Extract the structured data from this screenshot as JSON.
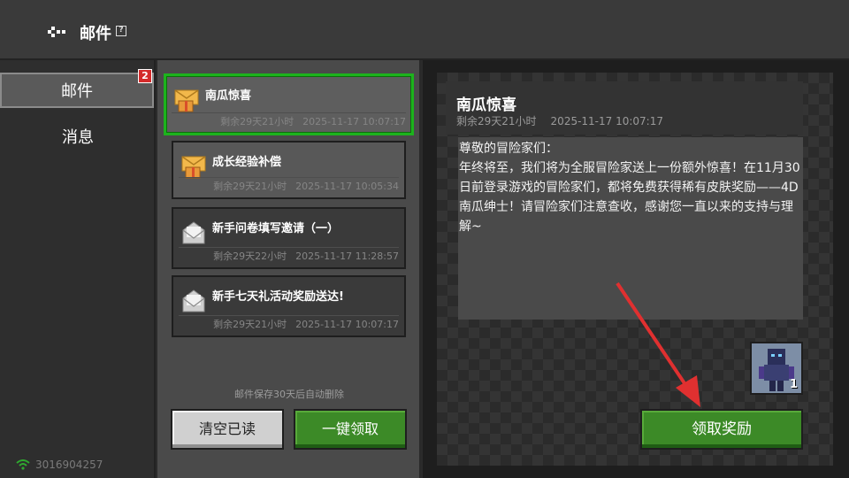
{
  "topbar": {
    "title": "邮件",
    "back_icon": "back-arrow-icon",
    "help_icon": "help-icon",
    "help_glyph": "?"
  },
  "sidebar": {
    "items": [
      {
        "label": "邮件",
        "active": true,
        "badge": "2"
      },
      {
        "label": "消息",
        "active": false
      }
    ],
    "uid": "3016904257"
  },
  "mails": [
    {
      "title": "南瓜惊喜",
      "remaining": "剩余29天21小时",
      "date": "2025-11-17 10:07:17",
      "icon": "gift-envelope-icon",
      "state": "selected"
    },
    {
      "title": "成长经验补偿",
      "remaining": "剩余29天21小时",
      "date": "2025-11-17 10:05:34",
      "icon": "gift-envelope-icon",
      "state": "unread"
    },
    {
      "title": "新手问卷填写邀请（一）",
      "remaining": "剩余29天22小时",
      "date": "2025-11-17 11:28:57",
      "icon": "open-envelope-icon",
      "state": "read"
    },
    {
      "title": "新手七天礼活动奖励送达!",
      "remaining": "剩余29天21小时",
      "date": "2025-11-17 10:07:17",
      "icon": "open-envelope-icon",
      "state": "read"
    }
  ],
  "list_footer": {
    "hint": "邮件保存30天后自动删除",
    "clear_read_label": "清空已读",
    "claim_all_label": "一键领取"
  },
  "detail": {
    "title": "南瓜惊喜",
    "remaining": "剩余29天21小时",
    "date": "2025-11-17 10:07:17",
    "body_lines": [
      "尊敬的冒险家们：",
      "年终将至，我们将为全服冒险家送上一份额外惊喜！在11月30日前登录游戏的冒险家们，都将免费获得稀有皮肤奖励——4D南瓜绅士！请冒险家们注意查收，感谢您一直以来的支持与理解~"
    ],
    "reward": {
      "icon": "skin-reward-icon",
      "count": "1"
    },
    "claim_label": "领取奖励"
  },
  "colors": {
    "accent_green": "#3c8a27",
    "selected_border": "#1db31d",
    "badge_red": "#d42a2a",
    "arrow_red": "#e03030"
  }
}
